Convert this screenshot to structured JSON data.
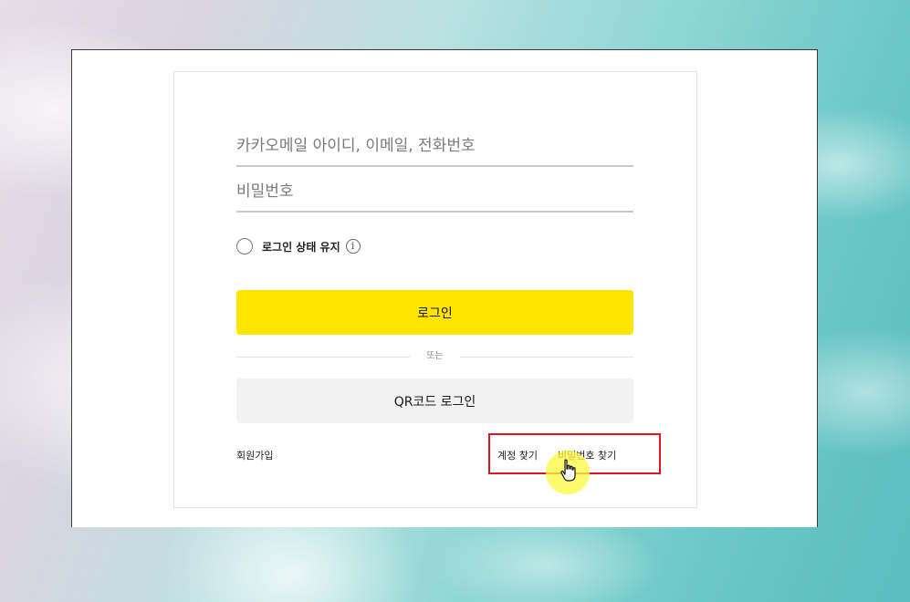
{
  "login_form": {
    "id_placeholder": "카카오메일 아이디, 이메일, 전화번호",
    "password_placeholder": "비밀번호",
    "keep_logged_in_label": "로그인 상태 유지",
    "info_icon_glyph": "i",
    "login_button": "로그인",
    "divider_text": "또는",
    "qr_login_button": "QR코드 로그인",
    "signup_link": "회원가입",
    "find_account_link": "계정 찾기",
    "find_password_link": "비밀번호 찾기"
  },
  "colors": {
    "login_button_bg": "#fee500",
    "qr_button_bg": "#f2f2f2",
    "highlight_box": "#e0141f",
    "cursor_halo": "#fffa3c"
  },
  "icons": {
    "radio": "radio-unchecked-icon",
    "info": "info-icon",
    "cursor": "hand-pointer-icon"
  }
}
